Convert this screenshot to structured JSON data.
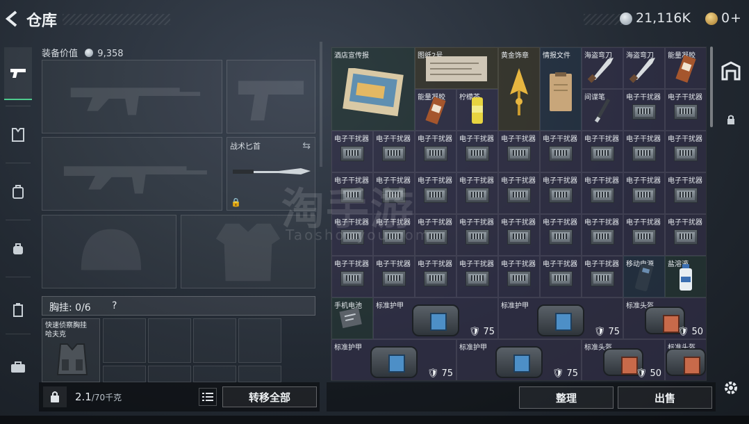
{
  "header": {
    "title": "仓库",
    "silver_amount": "21,116K",
    "gold_amount": "0"
  },
  "left_nav": [
    "weapons-icon",
    "armor-icon",
    "backpack-icon",
    "bag-icon",
    "container-icon",
    "case-icon"
  ],
  "equipment": {
    "value_label": "装备价值",
    "value": "9,358",
    "knife_slot_label": "战术匕首",
    "chest_rig_label": "胸挂:",
    "chest_rig_count": "0/6",
    "chest_rig_help": "?",
    "chest_item_name": "快速侦察胸挂\n哈夫克"
  },
  "footer_left": {
    "weight": "2.1",
    "weight_max": "/70千克",
    "kg_badge": "KG",
    "transfer_all": "转移全部"
  },
  "footer_right": {
    "sort": "整理",
    "sell": "出售"
  },
  "watermark": {
    "cn": "淘手游",
    "en": "Taoshouyou.com"
  },
  "inventory": [
    {
      "name": "酒店宣传报",
      "type": "poster",
      "color": "green"
    },
    {
      "name": "图纸2号",
      "type": "paper",
      "color": "gold"
    },
    {
      "name": "黄金饰章",
      "type": "badge",
      "color": "gold"
    },
    {
      "name": "情报文件",
      "type": "file",
      "color": "blue"
    },
    {
      "name": "海盗弯刀",
      "type": "blade",
      "color": "purple"
    },
    {
      "name": "海盗弯刀",
      "type": "blade",
      "color": "purple"
    },
    {
      "name": "能量凝胶",
      "type": "gel",
      "color": "purple"
    },
    {
      "name": "能量凝胶",
      "type": "gel",
      "color": "purple"
    },
    {
      "name": "柠檬茶",
      "type": "can",
      "color": "purple"
    },
    {
      "name": "间谍笔",
      "type": "pen",
      "color": "purple"
    },
    {
      "name": "电子干扰器",
      "type": "chip",
      "color": "purple"
    },
    {
      "name": "电子干扰器",
      "type": "chip",
      "color": "purple"
    },
    {
      "name": "电子干扰器",
      "type": "chip",
      "color": "purple"
    },
    {
      "name": "移动电源",
      "type": "power",
      "color": "blue"
    },
    {
      "name": "盐溶液",
      "type": "bottle",
      "color": "green"
    },
    {
      "name": "手机电池",
      "type": "battery",
      "color": "green"
    },
    {
      "name": "标准护甲",
      "type": "vest",
      "color": "purple",
      "armor": "75"
    },
    {
      "name": "标准护甲",
      "type": "vest",
      "color": "purple",
      "armor": "75"
    },
    {
      "name": "标准头盔",
      "type": "helmet",
      "color": "purple",
      "armor": "50"
    },
    {
      "name": "标准护甲",
      "type": "vest",
      "color": "purple",
      "armor": "75"
    },
    {
      "name": "标准护甲",
      "type": "vest",
      "color": "purple",
      "armor": "75"
    },
    {
      "name": "标准头盔",
      "type": "helmet",
      "color": "purple",
      "armor": "50"
    },
    {
      "name": "标准头盔",
      "type": "helmet",
      "color": "purple"
    }
  ]
}
